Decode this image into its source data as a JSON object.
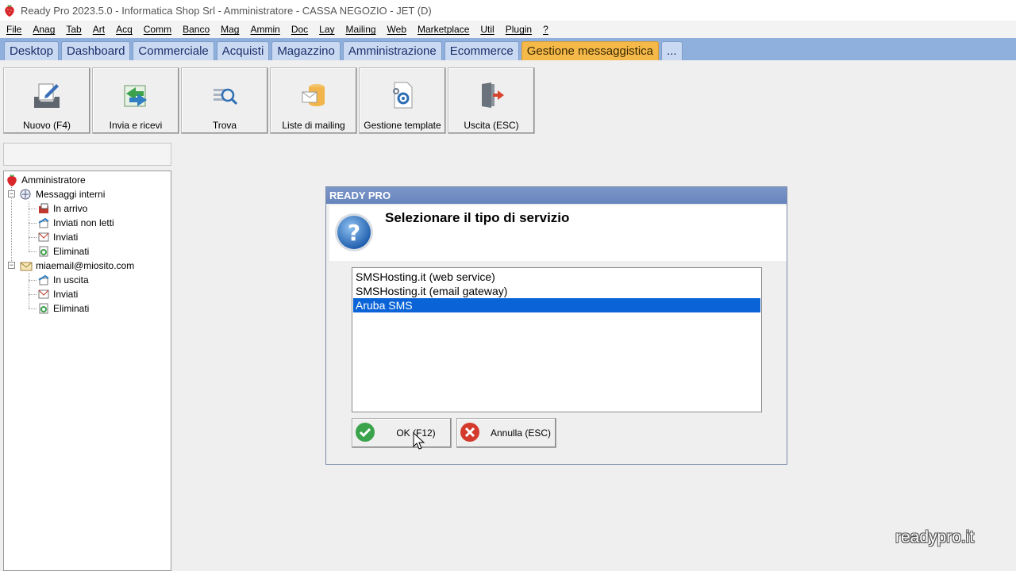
{
  "window": {
    "title": "Ready Pro 2023.5.0 - Informatica Shop Srl - Amministratore - CASSA NEGOZIO - JET (D)"
  },
  "menu": [
    "File",
    "Anag",
    "Tab",
    "Art",
    "Acq",
    "Comm",
    "Banco",
    "Mag",
    "Ammin",
    "Doc",
    "Lay",
    "Mailing",
    "Web",
    "Marketplace",
    "Util",
    "Plugin",
    "?"
  ],
  "tabs": [
    "Desktop",
    "Dashboard",
    "Commerciale",
    "Acquisti",
    "Magazzino",
    "Amministrazione",
    "Ecommerce",
    "Gestione messaggistica",
    "..."
  ],
  "active_tab": "Gestione messaggistica",
  "toolbar": {
    "new_label": "Nuovo (F4)",
    "sendreceive_label": "Invia e ricevi",
    "find_label": "Trova",
    "mailinglists_label": "Liste di mailing",
    "templates_label": "Gestione template",
    "exit_label": "Uscita (ESC)"
  },
  "tree": {
    "root": "Amministratore",
    "internal": {
      "label": "Messaggi interni",
      "children": [
        "In arrivo",
        "Inviati non letti",
        "Inviati",
        "Eliminati"
      ]
    },
    "account": {
      "label": "miaemail@miosito.com",
      "children": [
        "In uscita",
        "Inviati",
        "Eliminati"
      ]
    }
  },
  "dialog": {
    "title": "READY PRO",
    "prompt": "Selezionare il tipo di servizio",
    "options": [
      "SMSHosting.it (web service)",
      "SMSHosting.it (email gateway)",
      "Aruba SMS"
    ],
    "selected_index": 2,
    "ok_label": "OK (F12)",
    "cancel_label": "Annulla (ESC)"
  },
  "watermark": "readypro.it",
  "colors": {
    "tab_bar": "#8fb0dc",
    "active_tab": "#f5b94a",
    "selection": "#0a64d8",
    "dialog_title": "#6f8cc2",
    "ok_icon": "#3aa34b",
    "cancel_icon": "#d33a2c"
  }
}
